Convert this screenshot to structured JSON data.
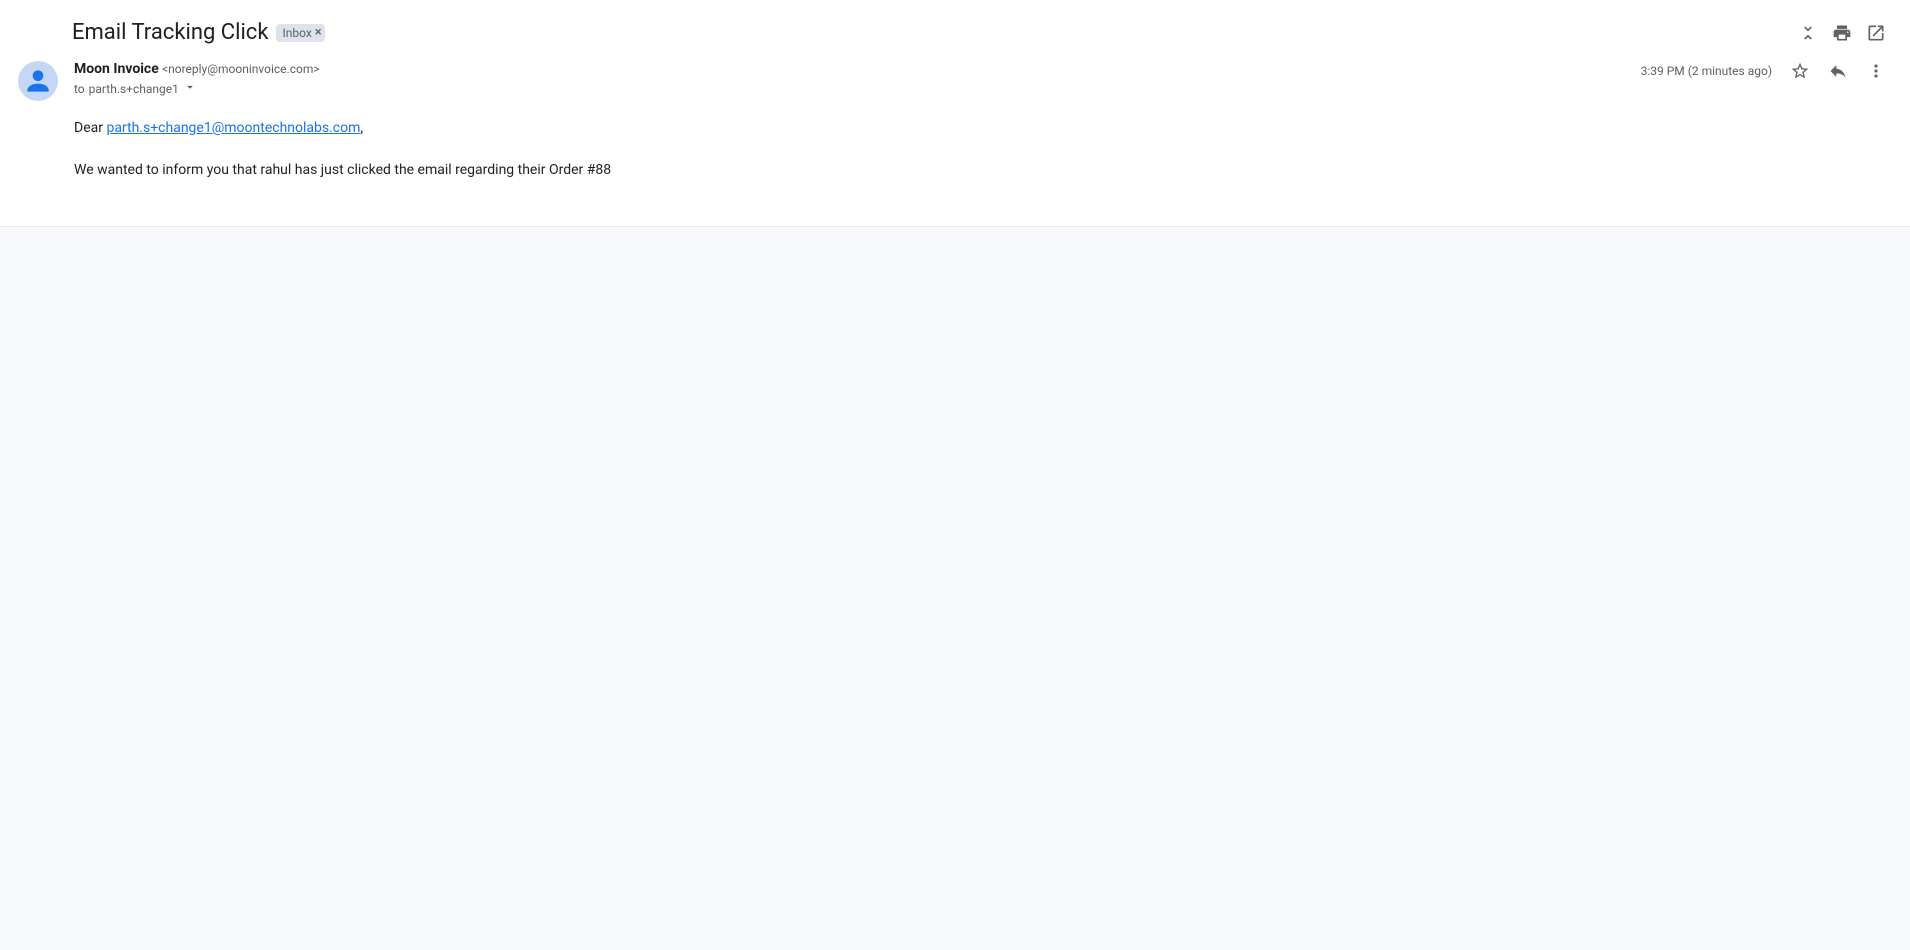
{
  "header": {
    "subject": "Email Tracking Click",
    "label": "Inbox"
  },
  "sender": {
    "name": "Moon Invoice",
    "email": "<noreply@mooninvoice.com>",
    "recipient_prefix": "to",
    "recipient": "parth.s+change1"
  },
  "meta": {
    "time": "3:39 PM",
    "relative": "(2 minutes ago)"
  },
  "body": {
    "greeting_prefix": "Dear ",
    "greeting_link": "parth.s+change1@moontechnolabs.com",
    "greeting_suffix": ",",
    "paragraph": "We wanted to inform you that rahul has just clicked the email regarding their Order #88"
  }
}
